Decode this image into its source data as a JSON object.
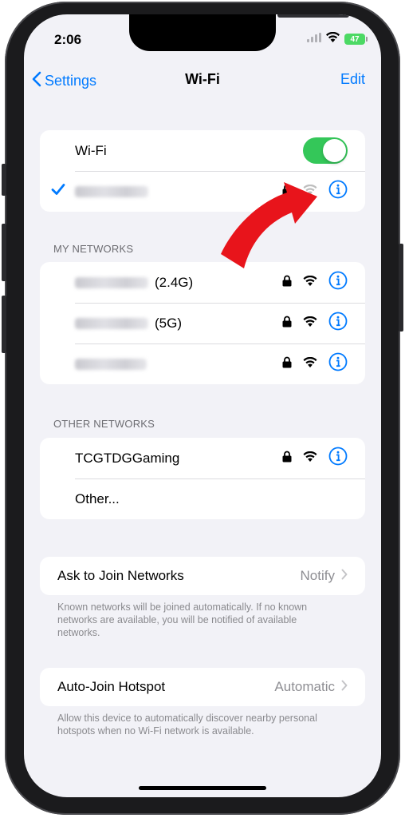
{
  "status_bar": {
    "time": "2:06",
    "battery_level": "47"
  },
  "nav": {
    "back_label": "Settings",
    "title": "Wi-Fi",
    "edit_label": "Edit"
  },
  "wifi": {
    "toggle_label": "Wi-Fi",
    "enabled": true
  },
  "my_networks": {
    "header": "MY NETWORKS",
    "items": [
      {
        "suffix": "(2.4G)"
      },
      {
        "suffix": "(5G)"
      },
      {
        "suffix": ""
      }
    ]
  },
  "other_networks": {
    "header": "OTHER NETWORKS",
    "items": [
      {
        "name": "TCGTDGGaming"
      },
      {
        "name": "Other..."
      }
    ]
  },
  "ask_to_join": {
    "label": "Ask to Join Networks",
    "value": "Notify",
    "note": "Known networks will be joined automatically. If no known networks are available, you will be notified of available networks."
  },
  "auto_join": {
    "label": "Auto-Join Hotspot",
    "value": "Automatic",
    "note": "Allow this device to automatically discover nearby personal hotspots when no Wi-Fi network is available."
  },
  "colors": {
    "accent": "#007aff",
    "toggle_on": "#34c759",
    "arrow": "#e8141b"
  }
}
